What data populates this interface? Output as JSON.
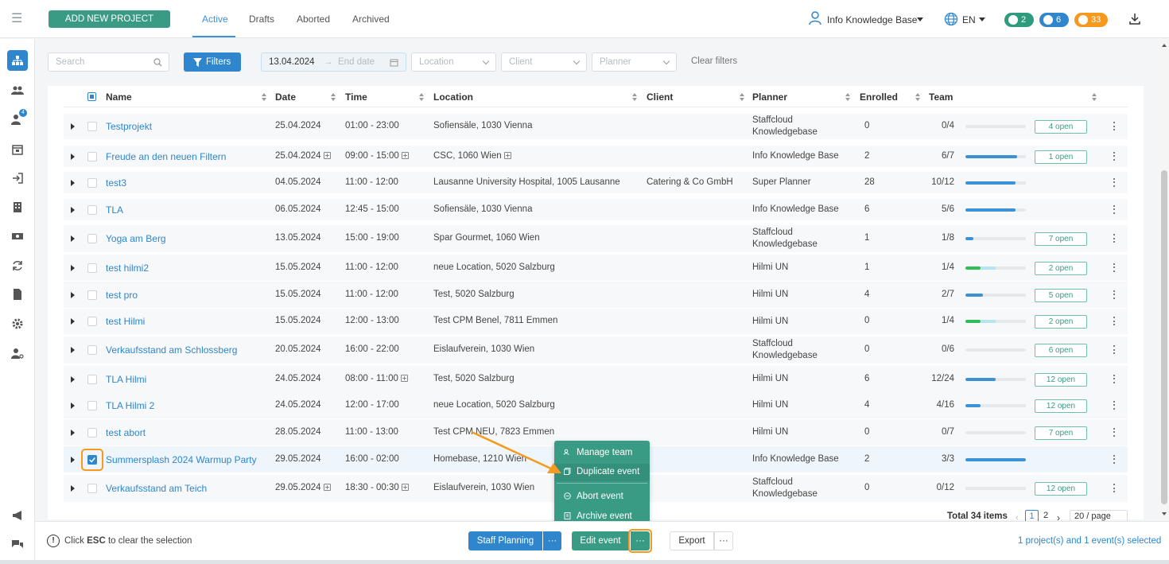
{
  "header": {
    "add_project": "ADD NEW PROJECT",
    "tabs": [
      {
        "label": "Active"
      },
      {
        "label": "Drafts"
      },
      {
        "label": "Aborted"
      },
      {
        "label": "Archived"
      }
    ],
    "user_name": "Info Knowledge Base",
    "language": "EN",
    "badges": [
      {
        "count": "2",
        "color": "#2e9b7f"
      },
      {
        "count": "6",
        "color": "#2f86cc"
      },
      {
        "count": "33",
        "color": "#f59a1e"
      }
    ]
  },
  "sidebar": {
    "icons": [
      "org-chart-icon",
      "users-group-icon",
      "add-user-icon",
      "calendar-icon",
      "login-icon",
      "building-icon",
      "money-icon",
      "refresh-icon",
      "document-icon",
      "settings-icon",
      "user-settings-icon",
      "megaphone-icon",
      "chat-icon"
    ],
    "badge_count": "4"
  },
  "filters": {
    "search_placeholder": "Search",
    "filters_label": "Filters",
    "start_date": "13.04.2024",
    "end_date_placeholder": "End date",
    "location_placeholder": "Location",
    "client_placeholder": "Client",
    "planner_placeholder": "Planner",
    "clear_filters": "Clear filters"
  },
  "table": {
    "columns": [
      "Name",
      "Date",
      "Time",
      "Location",
      "Client",
      "Planner",
      "Enrolled",
      "Team"
    ],
    "rows": [
      {
        "name": "Testprojekt",
        "date": "25.04.2024",
        "time": "01:00 - 23:00",
        "location": "Sofiensäle, 1030 Vienna",
        "client": "",
        "planner": "Staffcloud Knowledgebase",
        "enrolled": "0",
        "team": "0/4",
        "fill": 0,
        "open": "4 open"
      },
      {
        "name": "Freude an den neuen Filtern",
        "date": "25.04.2024",
        "time": "09:00 - 15:00",
        "location": "CSC, 1060 Wien",
        "client": "",
        "planner": "Info Knowledge Base",
        "enrolled": "2",
        "team": "6/7",
        "fill": 0.86,
        "open": "1 open"
      },
      {
        "name": "test3",
        "date": "04.05.2024",
        "time": "11:00 - 12:00",
        "location": "Lausanne University Hospital, 1005 Lausanne",
        "client": "Catering & Co GmbH",
        "planner": "Super Planner",
        "enrolled": "28",
        "team": "10/12",
        "fill": 0.83,
        "open": ""
      },
      {
        "name": "TLA",
        "date": "06.05.2024",
        "time": "12:45 - 15:00",
        "location": "Sofiensäle, 1030 Vienna",
        "client": "",
        "planner": "Info Knowledge Base",
        "enrolled": "6",
        "team": "5/6",
        "fill": 0.83,
        "open": ""
      },
      {
        "name": "Yoga am Berg",
        "date": "13.05.2024",
        "time": "15:00 - 19:00",
        "location": "Spar Gourmet, 1060 Wien",
        "client": "",
        "planner": "Staffcloud Knowledgebase",
        "enrolled": "1",
        "team": "1/8",
        "fill": 0.13,
        "open": "7 open"
      },
      {
        "name": "test hilmi2",
        "date": "15.05.2024",
        "time": "11:00 - 12:00",
        "location": "neue Location, 5020 Salzburg",
        "client": "",
        "planner": "Hilmi UN",
        "enrolled": "1",
        "team": "1/4",
        "fill": 0.25,
        "open": "2 open"
      },
      {
        "name": "test pro",
        "date": "15.05.2024",
        "time": "11:00 - 12:00",
        "location": "Test, 5020 Salzburg",
        "client": "",
        "planner": "Hilmi UN",
        "enrolled": "4",
        "team": "2/7",
        "fill": 0.29,
        "open": "5 open"
      },
      {
        "name": "test Hilmi",
        "date": "15.05.2024",
        "time": "12:00 - 13:00",
        "location": "Test CPM Benel, 7811 Emmen",
        "client": "",
        "planner": "Hilmi UN",
        "enrolled": "0",
        "team": "1/4",
        "fill": 0.25,
        "open": "2 open"
      },
      {
        "name": "Verkaufsstand am Schlossberg",
        "date": "20.05.2024",
        "time": "16:00 - 22:00",
        "location": "Eislaufverein, 1030 Wien",
        "client": "",
        "planner": "Staffcloud Knowledgebase",
        "enrolled": "0",
        "team": "0/6",
        "fill": 0,
        "open": "6 open"
      },
      {
        "name": "TLA Hilmi",
        "date": "24.05.2024",
        "time": "08:00 - 11:00",
        "location": "Test, 5020 Salzburg",
        "client": "",
        "planner": "Hilmi UN",
        "enrolled": "6",
        "team": "12/24",
        "fill": 0.5,
        "open": "12 open"
      },
      {
        "name": "TLA Hilmi 2",
        "date": "24.05.2024",
        "time": "12:00 - 17:00",
        "location": "neue Location, 5020 Salzburg",
        "client": "",
        "planner": "Hilmi UN",
        "enrolled": "4",
        "team": "4/16",
        "fill": 0.25,
        "open": "12 open"
      },
      {
        "name": "test abort",
        "date": "28.05.2024",
        "time": "11:00 - 13:00",
        "location": "Test CPM NEU, 7823 Emmen",
        "client": "",
        "planner": "Hilmi UN",
        "enrolled": "0",
        "team": "0/7",
        "fill": 0,
        "open": "7 open"
      },
      {
        "name": "Summersplash 2024 Warmup Party",
        "date": "29.05.2024",
        "time": "16:00 - 02:00",
        "location": "Homebase, 1210 Wien",
        "client": "",
        "planner": "Info Knowledge Base",
        "enrolled": "2",
        "team": "3/3",
        "fill": 1,
        "open": ""
      },
      {
        "name": "Verkaufsstand am Teich",
        "date": "29.05.2024",
        "time": "18:30 - 00:30",
        "location": "Eislaufverein, 1030 Wien",
        "client": "",
        "planner": "Staffcloud Knowledgebase",
        "enrolled": "0",
        "team": "0/12",
        "fill": 0,
        "open": "12 open"
      }
    ]
  },
  "pagination": {
    "total": "Total 34 items",
    "pages": [
      "1",
      "2"
    ],
    "page_size": "20 / page"
  },
  "context_menu": {
    "items": [
      "Manage team",
      "Duplicate event",
      "Abort event",
      "Archive event"
    ]
  },
  "bottom": {
    "hint_prefix": "Click ",
    "hint_key": "ESC",
    "hint_suffix": " to clear the selection",
    "staff_planning": "Staff Planning",
    "edit_event": "Edit event",
    "export": "Export",
    "more": "···",
    "selected_info": "1 project(s) and 1 event(s) selected"
  },
  "colors": {
    "primary": "#2f86cc",
    "green": "#3a9b84",
    "accent_orange": "#f59a1e"
  }
}
